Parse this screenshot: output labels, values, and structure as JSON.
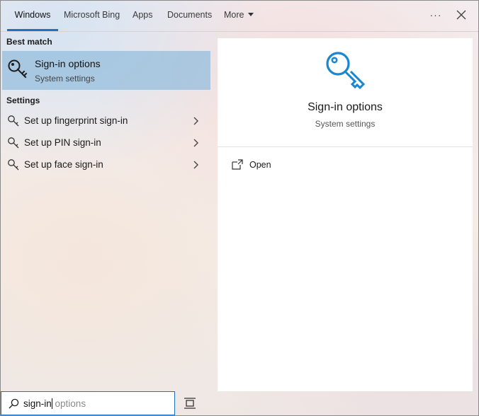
{
  "tabs": [
    {
      "label": "Windows",
      "active": true
    },
    {
      "label": "Microsoft Bing",
      "active": false
    },
    {
      "label": "Apps",
      "active": false
    },
    {
      "label": "Documents",
      "active": false
    },
    {
      "label": "More",
      "active": false
    }
  ],
  "header": {
    "more_options_label": "···"
  },
  "best_match": {
    "section_label": "Best match",
    "title": "Sign-in options",
    "subtitle": "System settings",
    "icon": "key-icon"
  },
  "settings": {
    "section_label": "Settings",
    "items": [
      {
        "label": "Set up fingerprint sign-in",
        "icon": "key-icon"
      },
      {
        "label": "Set up PIN sign-in",
        "icon": "key-icon"
      },
      {
        "label": "Set up face sign-in",
        "icon": "key-icon"
      }
    ]
  },
  "preview": {
    "title": "Sign-in options",
    "subtitle": "System settings",
    "actions": [
      {
        "label": "Open",
        "icon": "open-window-icon"
      }
    ]
  },
  "search": {
    "typed": "sign-in",
    "suggestion": " options"
  },
  "colors": {
    "accent": "#1a73c8",
    "selection": "#96bedc",
    "key_icon_preview": "#1a86d0"
  }
}
